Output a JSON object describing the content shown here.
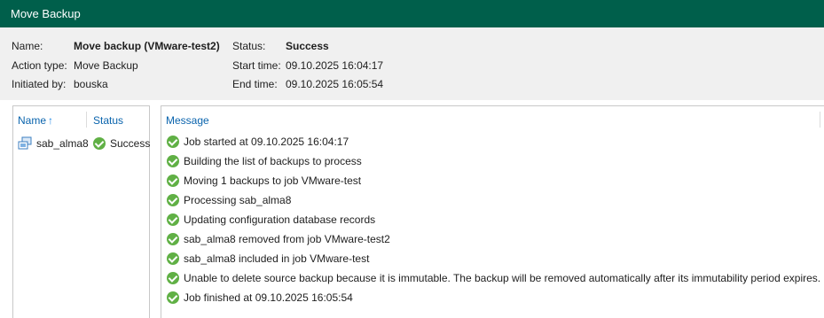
{
  "window": {
    "title": "Move Backup"
  },
  "summary": {
    "name_label": "Name:",
    "name_value": "Move backup (VMware-test2)",
    "action_label": "Action type:",
    "action_value": "Move Backup",
    "initiated_label": "Initiated by:",
    "initiated_value": "bouska",
    "status_label": "Status:",
    "status_value": "Success",
    "start_label": "Start time:",
    "start_value": "09.10.2025 16:04:17",
    "end_label": "End time:",
    "end_value": "09.10.2025 16:05:54"
  },
  "objects": {
    "columns": {
      "name": "Name",
      "status": "Status"
    },
    "sort_icon": "sort-up-arrow",
    "rows": [
      {
        "icon": "vm-icon",
        "name": "sab_alma8",
        "status": "Success"
      }
    ]
  },
  "log": {
    "column": "Message",
    "messages": [
      "Job started at 09.10.2025 16:04:17",
      "Building the list of backups to process",
      "Moving 1 backups to job VMware-test",
      "Processing sab_alma8",
      "Updating configuration database records",
      "sab_alma8 removed from job VMware-test2",
      "sab_alma8 included in job VMware-test",
      "Unable to delete source backup because it is immutable. The backup will be removed automatically after its immutability period expires.",
      "Job finished at 09.10.2025 16:05:54"
    ]
  },
  "colors": {
    "titlebar": "#005f4b",
    "header_bg": "#f0f0f0",
    "column_header": "#0a64ad",
    "success_icon": "#60b045"
  }
}
